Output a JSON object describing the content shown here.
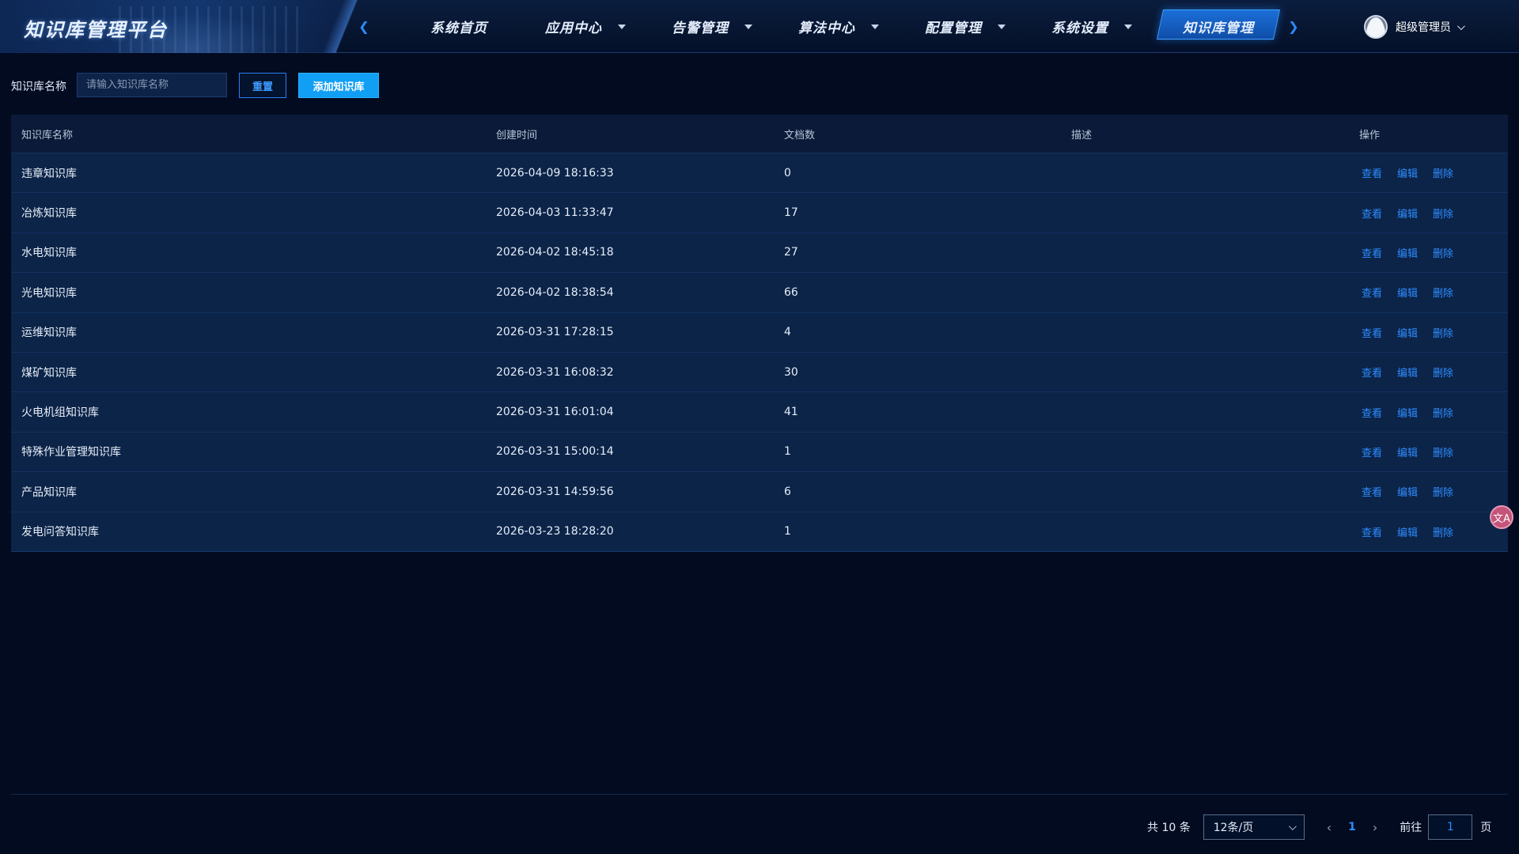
{
  "header": {
    "brand_title": "知识库管理平台",
    "nav_prev_icon": "chevron-left-icon",
    "nav_next_icon": "chevron-right-icon",
    "nav": [
      {
        "label": "系统首页",
        "has_dropdown": false,
        "active": false
      },
      {
        "label": "应用中心",
        "has_dropdown": true,
        "active": false
      },
      {
        "label": "告警管理",
        "has_dropdown": true,
        "active": false
      },
      {
        "label": "算法中心",
        "has_dropdown": true,
        "active": false
      },
      {
        "label": "配置管理",
        "has_dropdown": true,
        "active": false
      },
      {
        "label": "系统设置",
        "has_dropdown": true,
        "active": false
      },
      {
        "label": "知识库管理",
        "has_dropdown": false,
        "active": true
      }
    ],
    "user_name": "超级管理员"
  },
  "search": {
    "label": "知识库名称",
    "placeholder": "请输入知识库名称",
    "value": "",
    "reset_label": "重置",
    "add_label": "添加知识库"
  },
  "table": {
    "columns": [
      "知识库名称",
      "创建时间",
      "文档数",
      "描述",
      "操作"
    ],
    "rows": [
      {
        "name": "违章知识库",
        "created": "2026-04-09 18:16:33",
        "docs": "0",
        "desc": ""
      },
      {
        "name": "冶炼知识库",
        "created": "2026-04-03 11:33:47",
        "docs": "17",
        "desc": ""
      },
      {
        "name": "水电知识库",
        "created": "2026-04-02 18:45:18",
        "docs": "27",
        "desc": ""
      },
      {
        "name": "光电知识库",
        "created": "2026-04-02 18:38:54",
        "docs": "66",
        "desc": ""
      },
      {
        "name": "运维知识库",
        "created": "2026-03-31 17:28:15",
        "docs": "4",
        "desc": ""
      },
      {
        "name": "煤矿知识库",
        "created": "2026-03-31 16:08:32",
        "docs": "30",
        "desc": ""
      },
      {
        "name": "火电机组知识库",
        "created": "2026-03-31 16:01:04",
        "docs": "41",
        "desc": ""
      },
      {
        "name": "特殊作业管理知识库",
        "created": "2026-03-31 15:00:14",
        "docs": "1",
        "desc": ""
      },
      {
        "name": "产品知识库",
        "created": "2026-03-31 14:59:56",
        "docs": "6",
        "desc": ""
      },
      {
        "name": "发电问答知识库",
        "created": "2026-03-23 18:28:20",
        "docs": "1",
        "desc": ""
      }
    ],
    "actions": {
      "view": "查看",
      "edit": "编辑",
      "delete": "删除"
    }
  },
  "floating": {
    "icon": "translate-icon",
    "glyph": "文A"
  },
  "pagination": {
    "total_text": "共 10 条",
    "page_size": "12条/页",
    "prev_glyph": "‹",
    "next_glyph": "›",
    "current_page": "1",
    "goto_label": "前往",
    "goto_value": "1",
    "goto_suffix": "页"
  },
  "colors": {
    "background": "#030b21",
    "accent": "#2d8cff",
    "primary_button": "#119ef5",
    "row_bg": "#0c2448"
  }
}
